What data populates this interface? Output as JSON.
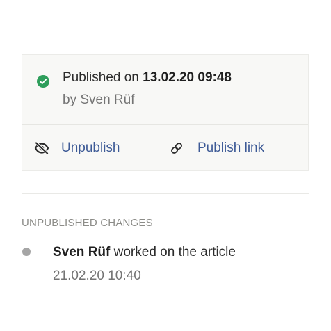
{
  "publish_status": {
    "label": "Published on",
    "datetime": "13.02.20 09:48",
    "by_line": "by Sven Rüf",
    "status_color": "#2e9e5b"
  },
  "actions": {
    "unpublish_label": "Unpublish",
    "unpublish_icon": "eye-off-icon",
    "publish_link_label": "Publish link",
    "publish_link_icon": "link-icon",
    "link_color": "#3d5a96"
  },
  "unpublished_changes": {
    "title": "UNPUBLISHED CHANGES",
    "items": [
      {
        "author": "Sven Rüf",
        "action": "worked on the article",
        "datetime": "21.02.20 10:40"
      }
    ]
  }
}
